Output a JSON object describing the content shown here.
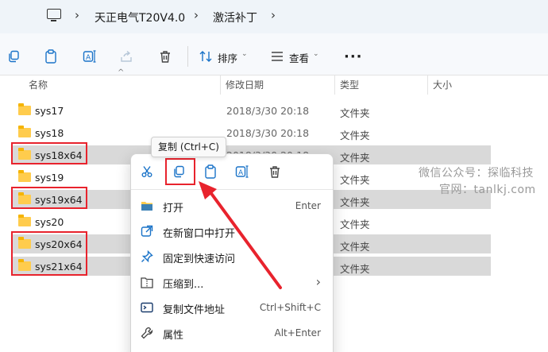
{
  "breadcrumb": {
    "items": [
      "天正电气T20V4.0",
      "激活补丁"
    ]
  },
  "toolbar": {
    "sort_label": "排序",
    "view_label": "查看",
    "more_label": "···"
  },
  "columns": {
    "name": "名称",
    "date": "修改日期",
    "type": "类型",
    "size": "大小"
  },
  "rows": [
    {
      "name": "sys17",
      "date": "2018/3/30 20:18",
      "type": "文件夹",
      "selected": false
    },
    {
      "name": "sys18",
      "date": "2018/3/30 20:18",
      "type": "文件夹",
      "selected": false
    },
    {
      "name": "sys18x64",
      "date": "2018/3/30 20:18",
      "type": "文件夹",
      "selected": true
    },
    {
      "name": "sys19",
      "date": "",
      "type": "文件夹",
      "selected": false
    },
    {
      "name": "sys19x64",
      "date": "",
      "type": "文件夹",
      "selected": true
    },
    {
      "name": "sys20",
      "date": "",
      "type": "文件夹",
      "selected": false
    },
    {
      "name": "sys20x64",
      "date": "",
      "type": "文件夹",
      "selected": true
    },
    {
      "name": "sys21x64",
      "date": "",
      "type": "文件夹",
      "selected": true
    }
  ],
  "tooltip": "复制 (Ctrl+C)",
  "context_menu": {
    "items": [
      {
        "label": "打开",
        "shortcut": "Enter",
        "icon": "folder-open-icon"
      },
      {
        "label": "在新窗口中打开",
        "shortcut": "",
        "icon": "external-window-icon"
      },
      {
        "label": "固定到快速访问",
        "shortcut": "",
        "icon": "pin-icon"
      },
      {
        "label": "压缩到...",
        "shortcut": "",
        "icon": "archive-icon"
      },
      {
        "label": "复制文件地址",
        "shortcut": "Ctrl+Shift+C",
        "icon": "path-icon"
      },
      {
        "label": "属性",
        "shortcut": "Alt+Enter",
        "icon": "wrench-icon"
      }
    ]
  },
  "watermark": {
    "line1": "微信公众号：探临科技",
    "line2": "官网：tanlkj.com"
  },
  "colors": {
    "highlight": "#e8232d",
    "selection": "#d9d9d9",
    "folder": "#ffcc4d",
    "accent": "#1a73c8"
  }
}
